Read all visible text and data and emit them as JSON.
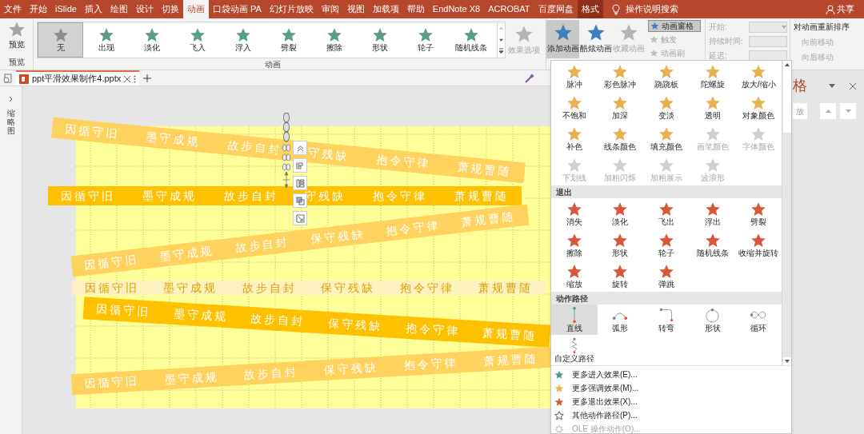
{
  "tabs": [
    {
      "label": "文件",
      "selected": false,
      "contextual": false
    },
    {
      "label": "开始",
      "selected": false,
      "contextual": false
    },
    {
      "label": "iSlide",
      "selected": false,
      "contextual": false
    },
    {
      "label": "插入",
      "selected": false,
      "contextual": false
    },
    {
      "label": "绘图",
      "selected": false,
      "contextual": false
    },
    {
      "label": "设计",
      "selected": false,
      "contextual": false
    },
    {
      "label": "切换",
      "selected": false,
      "contextual": false
    },
    {
      "label": "动画",
      "selected": true,
      "contextual": false
    },
    {
      "label": "口袋动画 PA",
      "selected": false,
      "contextual": false
    },
    {
      "label": "幻灯片放映",
      "selected": false,
      "contextual": false
    },
    {
      "label": "审阅",
      "selected": false,
      "contextual": false
    },
    {
      "label": "视图",
      "selected": false,
      "contextual": false
    },
    {
      "label": "加载项",
      "selected": false,
      "contextual": false
    },
    {
      "label": "帮助",
      "selected": false,
      "contextual": false
    },
    {
      "label": "EndNote X8",
      "selected": false,
      "contextual": false
    },
    {
      "label": "ACROBAT",
      "selected": false,
      "contextual": false
    },
    {
      "label": "百度网盘",
      "selected": false,
      "contextual": false
    },
    {
      "label": "格式",
      "selected": false,
      "contextual": true
    }
  ],
  "search": "操作说明搜索",
  "share": "共享",
  "ribbon": {
    "preview": {
      "label": "预览",
      "group": "预览"
    },
    "gallery": {
      "group": "动画",
      "items": [
        {
          "label": "无",
          "kind": "none",
          "selected": true
        },
        {
          "label": "出现",
          "kind": "entrance",
          "selected": false
        },
        {
          "label": "淡化",
          "kind": "entrance",
          "selected": false
        },
        {
          "label": "飞入",
          "kind": "entrance",
          "selected": false
        },
        {
          "label": "浮入",
          "kind": "entrance",
          "selected": false
        },
        {
          "label": "劈裂",
          "kind": "entrance",
          "selected": false
        },
        {
          "label": "擦除",
          "kind": "entrance",
          "selected": false
        },
        {
          "label": "形状",
          "kind": "entrance",
          "selected": false
        },
        {
          "label": "轮子",
          "kind": "entrance",
          "selected": false
        },
        {
          "label": "随机线条",
          "kind": "entrance",
          "selected": false
        }
      ]
    },
    "effect_options": {
      "label": "效果选项",
      "disabled": true
    },
    "big_buttons": [
      {
        "label": "添加动画",
        "pressed": true,
        "disabled": false
      },
      {
        "label": "酷炫动画",
        "pressed": false,
        "disabled": false
      },
      {
        "label": "收藏动画",
        "pressed": false,
        "disabled": true
      }
    ],
    "small_buttons": [
      {
        "label": "动画窗格",
        "pressed": true,
        "disabled": false
      },
      {
        "label": "触发",
        "pressed": false,
        "disabled": true
      },
      {
        "label": "动画刷",
        "pressed": false,
        "disabled": true
      }
    ],
    "timing": [
      {
        "label": "开始:",
        "kind": "dropdown",
        "disabled": true
      },
      {
        "label": "持续时间:",
        "kind": "spinner",
        "disabled": true
      },
      {
        "label": "延迟:",
        "kind": "spinner",
        "disabled": true
      }
    ],
    "reorder": {
      "title": "对动画重新排序",
      "items": [
        {
          "label": "向前移动",
          "disabled": true
        },
        {
          "label": "向后移动",
          "disabled": true
        }
      ]
    }
  },
  "document_tab": {
    "title": "ppt平滑效果制作4.pptx"
  },
  "thumbnails_panel": {
    "label": "缩略图"
  },
  "slide": {
    "bands": [
      {
        "kind": "faded",
        "words": [
          "因循守旧",
          "墨守成规",
          "故步自封",
          "守残缺",
          "抱令守律",
          "萧规曹随"
        ]
      },
      {
        "kind": "solid",
        "words": [
          "因循守旧",
          "墨守成规",
          "故步自封",
          "守残缺",
          "抱令守律",
          "萧规曹随"
        ]
      },
      {
        "kind": "faded",
        "words": [
          "因循守旧",
          "墨守成规",
          "故步自封",
          "保守残缺",
          "抱令守律",
          "萧规曹随"
        ]
      },
      {
        "kind": "ghost",
        "words": [
          "因循守旧",
          "墨守成规",
          "故步自封",
          "保守残缺",
          "抱令守律",
          "萧规曹随"
        ]
      },
      {
        "kind": "solid",
        "words": [
          "因循守旧",
          "墨守成规",
          "故步自封",
          "保守残缺",
          "抱令守律",
          "萧规曹随"
        ]
      },
      {
        "kind": "faded",
        "words": [
          "因循守旧",
          "墨守成规",
          "故步自封",
          "保守残缺",
          "抱令守律",
          "萧规曹随"
        ]
      }
    ]
  },
  "animation_pane": {
    "title": "格",
    "play": "放"
  },
  "dropdown": {
    "emphasis": [
      {
        "label": "脉冲",
        "disabled": false
      },
      {
        "label": "彩色脉冲",
        "disabled": false
      },
      {
        "label": "跷跷板",
        "disabled": false
      },
      {
        "label": "陀螺旋",
        "disabled": false
      },
      {
        "label": "放大/缩小",
        "disabled": false
      },
      {
        "label": "不饱和",
        "disabled": false
      },
      {
        "label": "加深",
        "disabled": false
      },
      {
        "label": "变淡",
        "disabled": false
      },
      {
        "label": "透明",
        "disabled": false
      },
      {
        "label": "对象颜色",
        "disabled": false
      },
      {
        "label": "补色",
        "disabled": false
      },
      {
        "label": "线条颜色",
        "disabled": false
      },
      {
        "label": "填充颜色",
        "disabled": false
      },
      {
        "label": "画笔颜色",
        "disabled": true
      },
      {
        "label": "字体颜色",
        "disabled": true
      },
      {
        "label": "下划线",
        "disabled": true
      },
      {
        "label": "加粗闪烁",
        "disabled": true
      },
      {
        "label": "加粗展示",
        "disabled": true
      },
      {
        "label": "波浪形",
        "disabled": true
      }
    ],
    "exit": {
      "title": "退出",
      "items": [
        "消失",
        "淡化",
        "飞出",
        "浮出",
        "劈裂",
        "擦除",
        "形状",
        "轮子",
        "随机线条",
        "收缩并旋转",
        "缩放",
        "旋转",
        "弹跳"
      ]
    },
    "paths": {
      "title": "动作路径",
      "items": [
        {
          "label": "直线",
          "kind": "line",
          "selected": true
        },
        {
          "label": "弧形",
          "kind": "arc",
          "selected": false
        },
        {
          "label": "转弯",
          "kind": "turn",
          "selected": false
        },
        {
          "label": "形状",
          "kind": "circle",
          "selected": false
        },
        {
          "label": "循环",
          "kind": "loop",
          "selected": false
        },
        {
          "label": "自定义路径",
          "kind": "custom",
          "selected": false
        }
      ]
    },
    "menu": [
      {
        "label": "更多进入效果(E)...",
        "kind": "entrance",
        "disabled": false
      },
      {
        "label": "更多强调效果(M)...",
        "kind": "emphasis",
        "disabled": false
      },
      {
        "label": "更多退出效果(X)...",
        "kind": "exit",
        "disabled": false
      },
      {
        "label": "其他动作路径(P)...",
        "kind": "path",
        "disabled": false
      },
      {
        "label": "OLE 操作动作(O)...",
        "kind": "ole",
        "disabled": true
      }
    ]
  }
}
